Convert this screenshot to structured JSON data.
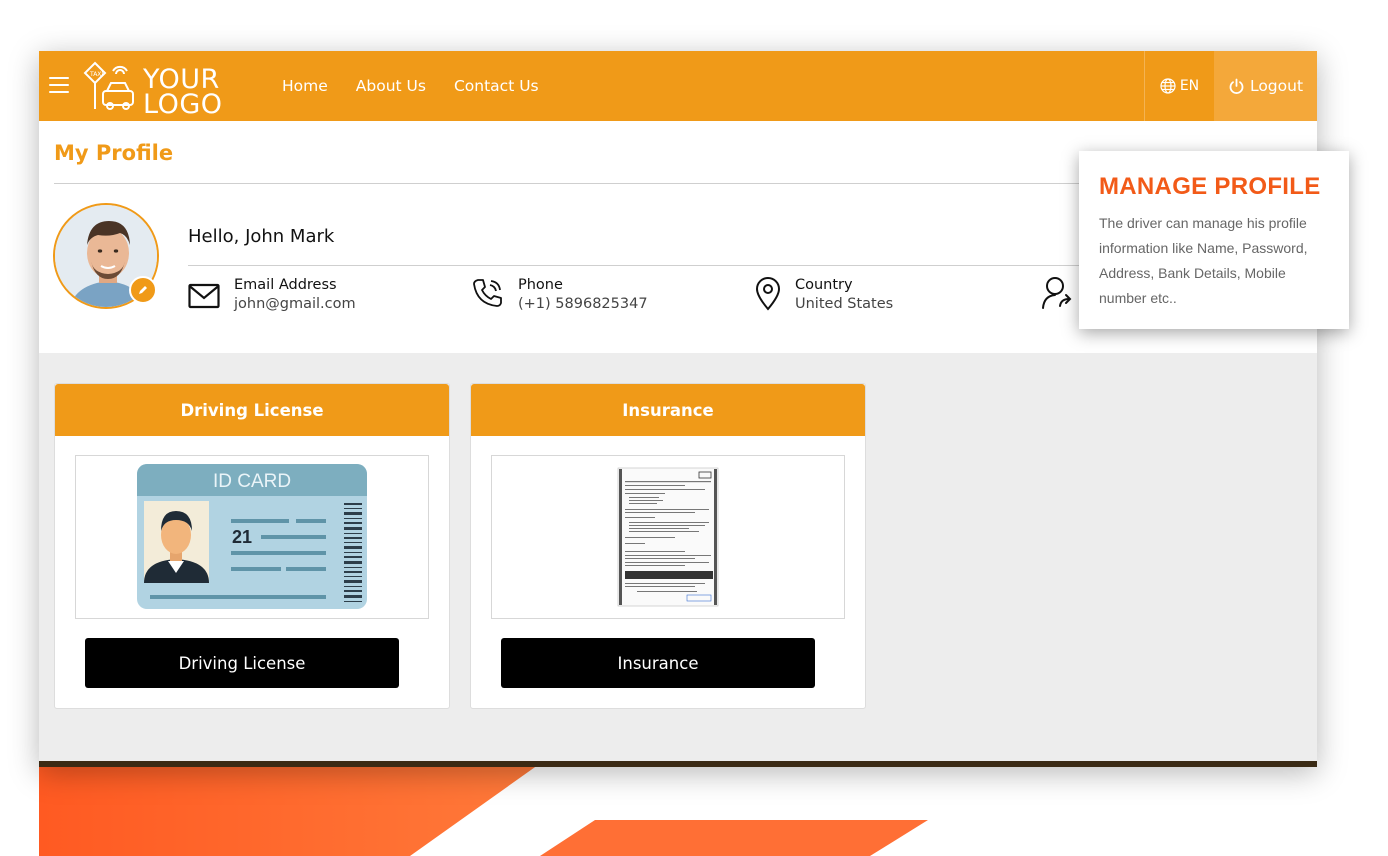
{
  "header": {
    "logo_line1": "YOUR",
    "logo_line2": "LOGO",
    "nav": [
      "Home",
      "About Us",
      "Contact Us"
    ],
    "language": "EN",
    "logout": "Logout"
  },
  "profile": {
    "page_title": "My Profile",
    "greeting": "Hello, John Mark",
    "email_label": "Email Address",
    "email_value": "john@gmail.com",
    "phone_label": "Phone",
    "phone_value": "(+1) 5896825347",
    "country_label": "Country",
    "country_value": "United States"
  },
  "cards": [
    {
      "title": "Driving License",
      "image_label": "ID CARD",
      "image_number": "21",
      "button": "Driving License"
    },
    {
      "title": "Insurance",
      "button": "Insurance"
    }
  ],
  "callout": {
    "title": "MANAGE PROFILE",
    "text": "The driver can manage his profile information like Name, Password, Address, Bank Details, Mobile number etc.."
  },
  "colors": {
    "primary": "#f09a18",
    "accent": "#f25a18",
    "deco": "#ff6a2a"
  }
}
